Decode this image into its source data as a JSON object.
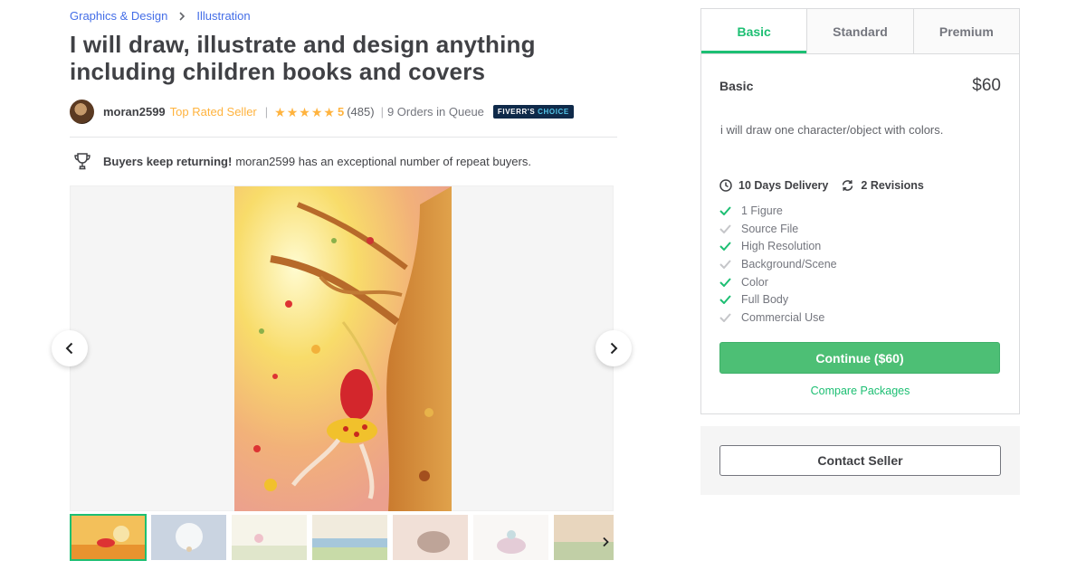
{
  "breadcrumb": {
    "category": "Graphics & Design",
    "subcategory": "Illustration"
  },
  "gig": {
    "title": "I will draw, illustrate and design anything including children books and covers"
  },
  "seller": {
    "username": "moran2599",
    "level": "Top Rated Seller",
    "rating": "5",
    "reviews": "(485)",
    "queue": "9 Orders in Queue",
    "badge_prefix": "FIVERR'S",
    "badge_suffix": "CHOICE"
  },
  "highlight": {
    "bold": "Buyers keep returning!",
    "text": "moran2599 has an exceptional number of repeat buyers."
  },
  "gallery": {
    "thumbnail_count": 7,
    "active_index": 0
  },
  "packages": {
    "tabs": [
      "Basic",
      "Standard",
      "Premium"
    ],
    "active_tab": "Basic",
    "name": "Basic",
    "price": "$60",
    "description": "i will draw one character/object with colors.",
    "delivery": "10 Days Delivery",
    "revisions": "2 Revisions",
    "features": [
      {
        "label": "1 Figure",
        "included": true
      },
      {
        "label": "Source File",
        "included": false
      },
      {
        "label": "High Resolution",
        "included": true
      },
      {
        "label": "Background/Scene",
        "included": false
      },
      {
        "label": "Color",
        "included": true
      },
      {
        "label": "Full Body",
        "included": true
      },
      {
        "label": "Commercial Use",
        "included": false
      }
    ],
    "continue_label": "Continue ($60)",
    "compare_label": "Compare Packages"
  },
  "contact": {
    "label": "Contact Seller"
  },
  "colors": {
    "accent": "#1dbf73",
    "link": "#446ee7",
    "star": "#ffb33e",
    "button": "#4dbf75"
  }
}
